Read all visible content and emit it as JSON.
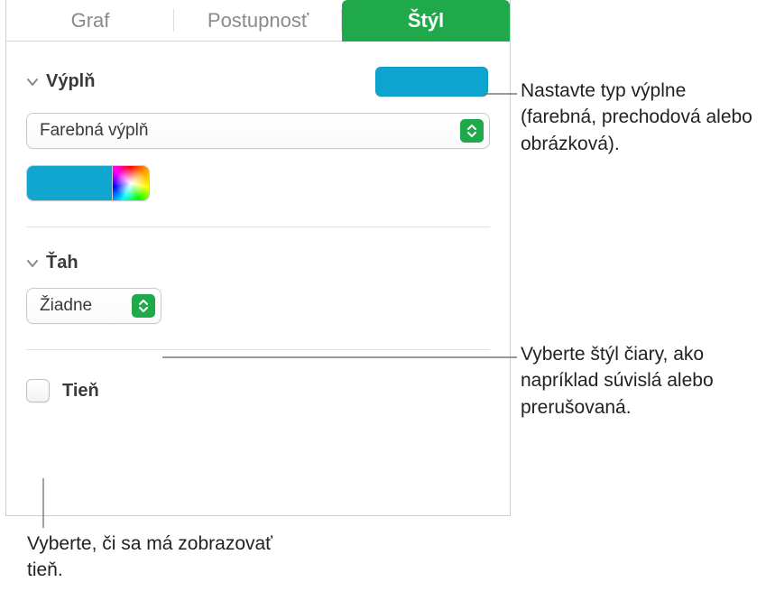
{
  "tabs": {
    "graf": "Graf",
    "postupnost": "Postupnosť",
    "styl": "Štýl"
  },
  "fill": {
    "title": "Výplň",
    "type_label": "Farebná výplň",
    "swatch_color": "#0ea4d0"
  },
  "stroke": {
    "title": "Ťah",
    "style_label": "Žiadne"
  },
  "shadow": {
    "title": "Tieň"
  },
  "callouts": {
    "fill": "Nastavte typ výplne (farebná, prechodová alebo obrázková).",
    "stroke": "Vyberte štýl čiary, ako napríklad súvislá alebo prerušovaná.",
    "shadow": "Vyberte, či sa má zobrazovať tieň."
  }
}
